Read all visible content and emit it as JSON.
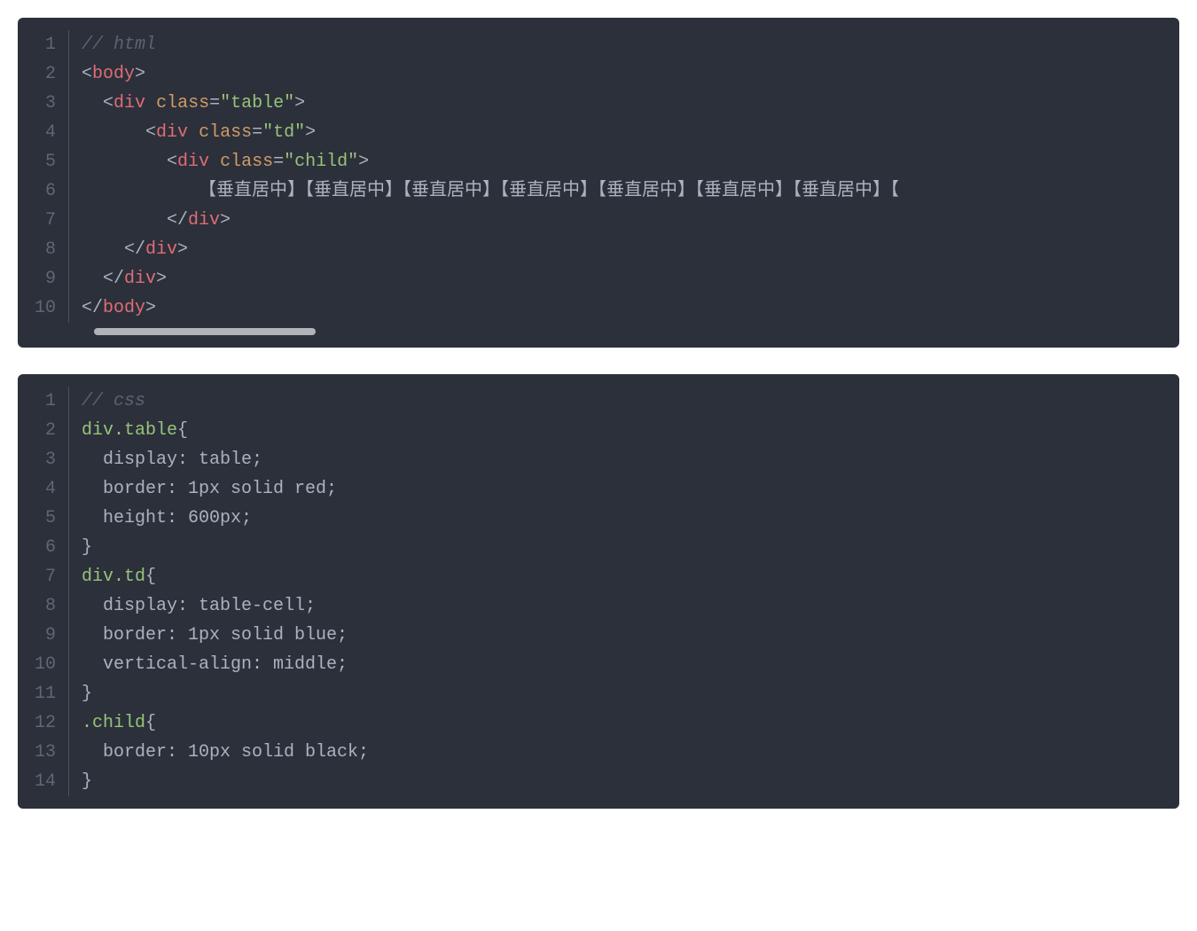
{
  "blocks": [
    {
      "name": "html-code-block",
      "hasScrollbar": true,
      "lines": [
        [
          {
            "cls": "tok-comment",
            "t": "// html"
          }
        ],
        [
          {
            "cls": "tok-punct",
            "t": "<"
          },
          {
            "cls": "tok-tag",
            "t": "body"
          },
          {
            "cls": "tok-punct",
            "t": ">"
          }
        ],
        [
          {
            "cls": "tok-text",
            "t": "  "
          },
          {
            "cls": "tok-punct",
            "t": "<"
          },
          {
            "cls": "tok-tag",
            "t": "div"
          },
          {
            "cls": "tok-text",
            "t": " "
          },
          {
            "cls": "tok-attr",
            "t": "class"
          },
          {
            "cls": "tok-punct",
            "t": "="
          },
          {
            "cls": "tok-string",
            "t": "\"table\""
          },
          {
            "cls": "tok-punct",
            "t": ">"
          }
        ],
        [
          {
            "cls": "tok-text",
            "t": "      "
          },
          {
            "cls": "tok-punct",
            "t": "<"
          },
          {
            "cls": "tok-tag",
            "t": "div"
          },
          {
            "cls": "tok-text",
            "t": " "
          },
          {
            "cls": "tok-attr",
            "t": "class"
          },
          {
            "cls": "tok-punct",
            "t": "="
          },
          {
            "cls": "tok-string",
            "t": "\"td\""
          },
          {
            "cls": "tok-punct",
            "t": ">"
          }
        ],
        [
          {
            "cls": "tok-text",
            "t": "        "
          },
          {
            "cls": "tok-punct",
            "t": "<"
          },
          {
            "cls": "tok-tag",
            "t": "div"
          },
          {
            "cls": "tok-text",
            "t": " "
          },
          {
            "cls": "tok-attr",
            "t": "class"
          },
          {
            "cls": "tok-punct",
            "t": "="
          },
          {
            "cls": "tok-string",
            "t": "\"child\""
          },
          {
            "cls": "tok-punct",
            "t": ">"
          }
        ],
        [
          {
            "cls": "tok-text",
            "t": "           【垂直居中】【垂直居中】【垂直居中】【垂直居中】【垂直居中】【垂直居中】【垂直居中】【"
          }
        ],
        [
          {
            "cls": "tok-text",
            "t": "        "
          },
          {
            "cls": "tok-punct",
            "t": "</"
          },
          {
            "cls": "tok-tag",
            "t": "div"
          },
          {
            "cls": "tok-punct",
            "t": ">"
          }
        ],
        [
          {
            "cls": "tok-text",
            "t": "    "
          },
          {
            "cls": "tok-punct",
            "t": "</"
          },
          {
            "cls": "tok-tag",
            "t": "div"
          },
          {
            "cls": "tok-punct",
            "t": ">"
          }
        ],
        [
          {
            "cls": "tok-text",
            "t": "  "
          },
          {
            "cls": "tok-punct",
            "t": "</"
          },
          {
            "cls": "tok-tag",
            "t": "div"
          },
          {
            "cls": "tok-punct",
            "t": ">"
          }
        ],
        [
          {
            "cls": "tok-punct",
            "t": "</"
          },
          {
            "cls": "tok-tag",
            "t": "body"
          },
          {
            "cls": "tok-punct",
            "t": ">"
          }
        ]
      ]
    },
    {
      "name": "css-code-block",
      "hasScrollbar": false,
      "lines": [
        [
          {
            "cls": "tok-comment",
            "t": "// css"
          }
        ],
        [
          {
            "cls": "tok-selector",
            "t": "div.table"
          },
          {
            "cls": "tok-brace",
            "t": "{"
          }
        ],
        [
          {
            "cls": "tok-prop",
            "t": "  display: table;"
          }
        ],
        [
          {
            "cls": "tok-prop",
            "t": "  border: 1px solid red;"
          }
        ],
        [
          {
            "cls": "tok-prop",
            "t": "  height: 600px;"
          }
        ],
        [
          {
            "cls": "tok-brace",
            "t": "}"
          }
        ],
        [
          {
            "cls": "tok-selector",
            "t": "div.td"
          },
          {
            "cls": "tok-brace",
            "t": "{"
          }
        ],
        [
          {
            "cls": "tok-prop",
            "t": "  display: table-cell;"
          }
        ],
        [
          {
            "cls": "tok-prop",
            "t": "  border: 1px solid blue;"
          }
        ],
        [
          {
            "cls": "tok-prop",
            "t": "  vertical-align: middle;"
          }
        ],
        [
          {
            "cls": "tok-brace",
            "t": "}"
          }
        ],
        [
          {
            "cls": "tok-selector",
            "t": ".child"
          },
          {
            "cls": "tok-brace",
            "t": "{"
          }
        ],
        [
          {
            "cls": "tok-prop",
            "t": "  border: 10px solid black;"
          }
        ],
        [
          {
            "cls": "tok-brace",
            "t": "}"
          }
        ]
      ]
    }
  ]
}
